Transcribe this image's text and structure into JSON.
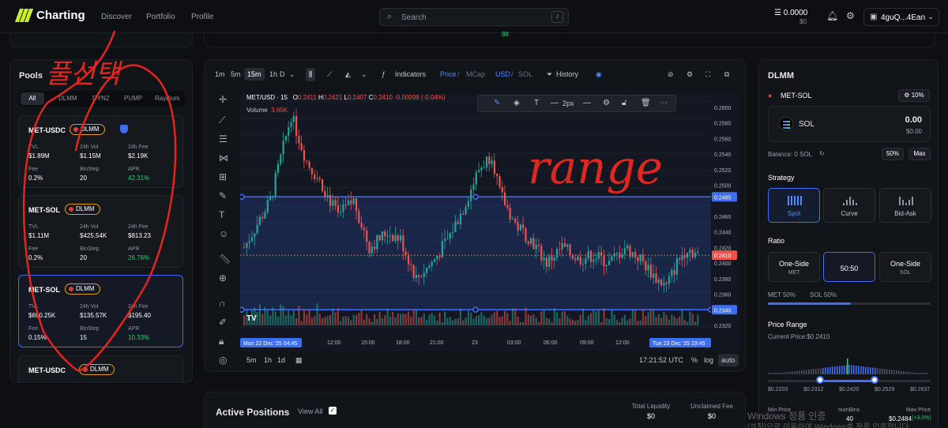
{
  "nav": {
    "brand": "Charting",
    "links": [
      "Discover",
      "Portfolio",
      "Profile"
    ],
    "search_placeholder": "Search",
    "search_shortcut": "/",
    "balance_main": "0.0000",
    "balance_sub": "$0",
    "wallet": "4guQ...4Ean"
  },
  "top_strip_value": "88",
  "pools": {
    "title": "Pools",
    "tabs": [
      "All",
      "DLMM",
      "DYN2",
      "PUMP",
      "Raydium"
    ],
    "label_tvl": "TVL",
    "label_vol": "24h Vol",
    "label_fee24": "24h Fee",
    "label_fee": "Fee",
    "label_binstep": "BinStep",
    "label_apr": "APR",
    "badge": "DLMM",
    "cards": [
      {
        "name": "MET-USDC",
        "tvl": "$1.89M",
        "vol": "$1.15M",
        "fee24": "$2.19K",
        "fee": "0.2%",
        "binstep": "20",
        "apr": "42.31%"
      },
      {
        "name": "MET-SOL",
        "tvl": "$1.11M",
        "vol": "$425.54K",
        "fee24": "$813.23",
        "fee": "0.2%",
        "binstep": "20",
        "apr": "26.76%"
      },
      {
        "name": "MET-SOL",
        "tvl": "$690.25K",
        "vol": "$135.57K",
        "fee24": "$195.40",
        "fee": "0.15%",
        "binstep": "15",
        "apr": "10.33%"
      },
      {
        "name": "MET-USDC"
      }
    ]
  },
  "chart": {
    "timeframes": [
      "1m",
      "5m",
      "15m",
      "1h",
      "D"
    ],
    "indicators": "Indicators",
    "price": "Price",
    "mcap": "MCap",
    "usd": "USD",
    "sol": "SOL",
    "history": "History",
    "symbol": "MET/USD · 15",
    "o": "O",
    "o_val": "0.2411",
    "h": "H",
    "h_val": "0.2421",
    "l": "L",
    "l_val": "0.2407",
    "c": "C",
    "c_val": "0.2410",
    "change": "-0.00098 (-0.04%)",
    "volume_label": "Volume",
    "volume_val": "3.65K",
    "stroke_width": "2px",
    "price_axis": [
      "0.2600",
      "0.2580",
      "0.2560",
      "0.2540",
      "0.2520",
      "0.2500",
      "0.2460",
      "0.2440",
      "0.2420",
      "0.2400",
      "0.2380",
      "0.2360",
      "0.2320"
    ],
    "range_top": "0.2485",
    "range_bottom": "0.2340",
    "current_price": "0.2410",
    "time_axis": [
      "12:00",
      "15:00",
      "18:00",
      "21:00",
      "23",
      "03:00",
      "06:00",
      "09:00",
      "12:00"
    ],
    "range_start_label": "Mon 22 Dec '25  04:45",
    "range_end_label": "Tue 23 Dec '25  19:45",
    "bottom_ranges": [
      "5m",
      "1h",
      "1d"
    ],
    "clock": "17:21:52 UTC",
    "pct": "%",
    "log": "log",
    "auto": "auto"
  },
  "positions": {
    "title": "Active Positions",
    "view_all": "View All",
    "total_liq_label": "Total Liquidity",
    "total_liq": "$0",
    "unclaimed_label": "Unclaimed Fee",
    "unclaimed": "$0"
  },
  "dlmm": {
    "title": "DLMM",
    "pair": "MET-SOL",
    "fee_chip": "10%",
    "token": "SOL",
    "amount": "0.00",
    "amount_usd": "$0.00",
    "balance": "Balance: 0 SOL",
    "chip50": "50%",
    "chipmax": "Max",
    "strategy_label": "Strategy",
    "strategies": [
      "Spot",
      "Curve",
      "Bid-Ask"
    ],
    "ratio_label": "Ratio",
    "ratio_one_side_a": "One-Side",
    "ratio_met": "MET",
    "ratio_mid": "50:50",
    "ratio_one_side_b": "One-Side",
    "ratio_sol": "SOL",
    "met_pct": "MET 50%",
    "sol_pct": "SOL 50%",
    "price_range_label": "Price Range",
    "current_price": "Current Price:$0.2410",
    "price_labels": [
      "$0.2203",
      "$0.2312",
      "$0.2420",
      "$0.2529",
      "$0.2637"
    ],
    "min_price_label": "Min Price",
    "num_bins_label": "numBins",
    "num_bins": "40",
    "max_price_label": "Max Price",
    "max_price": "$0.2484",
    "max_price_pct": "(+3.0%)"
  },
  "annotations": {
    "left_scribble": "풀선택",
    "range_scribble": "range"
  },
  "watermark": {
    "line1": "Windows 정품 인증",
    "line2": "[설정]으로 이동하여 Windows를 정품 인증합니다."
  },
  "colors": {
    "accent": "#3d6ef5",
    "brand": "#c8f02a",
    "up": "#26a69a",
    "down": "#ef5350",
    "scribble": "#e0261f"
  }
}
